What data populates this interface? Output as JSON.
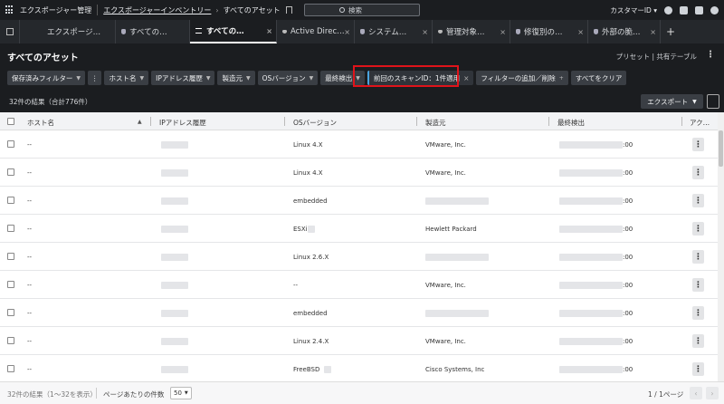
{
  "topbar": {
    "app_name": "エクスポージャー管理",
    "crumb_inventory": "エクスポージャーインベントリー",
    "crumb_current": "すべてのアセット",
    "search_label": "検索",
    "customer_label": "カスタマーID"
  },
  "tabs": [
    {
      "label": "エクスポージ…"
    },
    {
      "label": "すべての…"
    },
    {
      "label": "すべての…"
    },
    {
      "label": "Active Direc…"
    },
    {
      "label": "システム…"
    },
    {
      "label": "管理対象…"
    },
    {
      "label": "修復別の…"
    },
    {
      "label": "外部の脆…"
    }
  ],
  "page": {
    "title": "すべてのアセット",
    "preset_label": "プリセット | 共有テーブル",
    "results_count": "32件の結果（合計776件）",
    "export_label": "エクスポート"
  },
  "filters": {
    "saved": "保存済みフィルター",
    "host": "ホスト名",
    "ip_history": "IPアドレス履歴",
    "vendor": "製造元",
    "os_version": "OSバージョン",
    "last_seen": "最終検出",
    "applied": "前回のスキャンID：1件適用",
    "add_remove": "フィルターの追加／削除",
    "clear_all": "すべてをクリア"
  },
  "table": {
    "headers": {
      "host": "ホスト名",
      "ip": "IPアドレス履歴",
      "os": "OSバージョン",
      "vendor": "製造元",
      "last_seen": "最終検出",
      "action": "アク…"
    },
    "rows": [
      {
        "host": "--",
        "os": "Linux 4.X",
        "vendor": "VMware, Inc.",
        "time": ":00"
      },
      {
        "host": "--",
        "os": "Linux 4.X",
        "vendor": "VMware, Inc.",
        "time": ":00"
      },
      {
        "host": "--",
        "os": "embedded",
        "vendor": "",
        "time": ":00"
      },
      {
        "host": "--",
        "os": "ESXi",
        "vendor": "Hewlett Packard",
        "time": ":00"
      },
      {
        "host": "--",
        "os": "Linux 2.6.X",
        "vendor": "",
        "time": ":00"
      },
      {
        "host": "--",
        "os": "--",
        "vendor": "VMware, Inc.",
        "time": ":00"
      },
      {
        "host": "--",
        "os": "embedded",
        "vendor": "",
        "time": ":00"
      },
      {
        "host": "--",
        "os": "Linux 2.4.X",
        "vendor": "VMware, Inc.",
        "time": ":00"
      },
      {
        "host": "--",
        "os": "FreeBSD",
        "vendor": "Cisco Systems, Inc",
        "time": ":00"
      }
    ]
  },
  "footer": {
    "results": "32件の結果（1〜32を表示）",
    "per_page_label": "ページあたりの件数",
    "per_page_value": "50",
    "page_info": "1 / 1ページ"
  },
  "icons": {
    "grid": "apps-grid-icon",
    "search": "search-icon",
    "bell": "bell-icon",
    "help": "help-icon",
    "user": "user-icon",
    "kebab": "more-vertical-icon"
  },
  "colors": {
    "dark_bg": "#1b1d20",
    "tab_bg": "#25282c",
    "highlight": "#e0131a",
    "applied_accent": "#4aa3df"
  }
}
